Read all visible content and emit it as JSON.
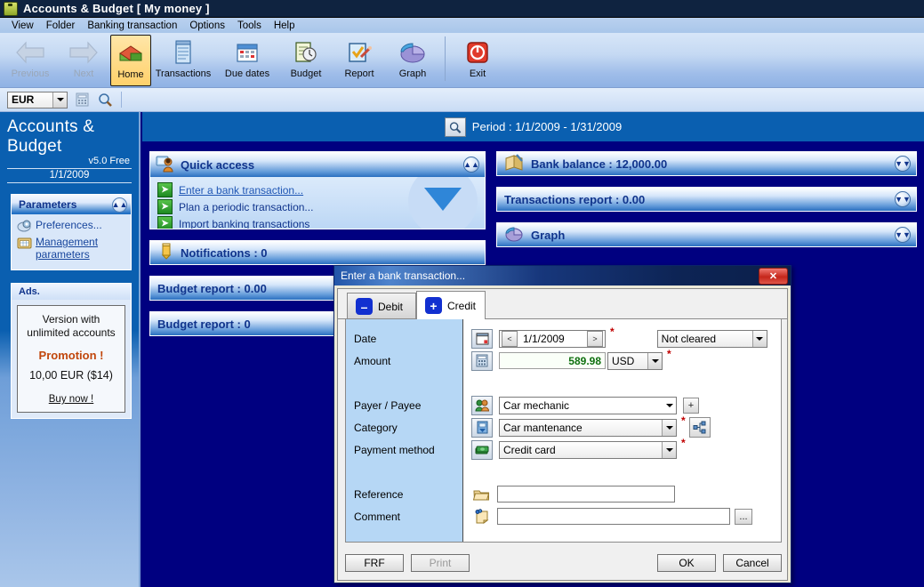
{
  "window": {
    "title": "Accounts & Budget [ My money ]",
    "icon": "money-bag-icon"
  },
  "menubar": {
    "items": [
      "View",
      "Folder",
      "Banking transaction",
      "Options",
      "Tools",
      "Help"
    ]
  },
  "toolbar": {
    "buttons": [
      {
        "label": "Previous",
        "icon": "left-arrow-icon",
        "enabled": false
      },
      {
        "label": "Next",
        "icon": "right-arrow-icon",
        "enabled": false
      },
      {
        "label": "Home",
        "icon": "house-icon",
        "enabled": true,
        "selected": true
      },
      {
        "label": "Transactions",
        "icon": "notepad-icon",
        "enabled": true
      },
      {
        "label": "Due dates",
        "icon": "calendar-icon",
        "enabled": true
      },
      {
        "label": "Budget",
        "icon": "clipboard-clock-icon",
        "enabled": true
      },
      {
        "label": "Report",
        "icon": "checklist-pen-icon",
        "enabled": true
      },
      {
        "label": "Graph",
        "icon": "pie-chart-icon",
        "enabled": true
      },
      {
        "label": "Exit",
        "icon": "power-icon",
        "enabled": true
      }
    ]
  },
  "currency_bar": {
    "selected_currency": "EUR",
    "calculator_icon": "calculator-icon",
    "search_icon": "magnifier-icon"
  },
  "sidebar": {
    "app_title": "Accounts & Budget",
    "version": "v5.0 Free",
    "date": "1/1/2009",
    "parameters_panel": {
      "title": "Parameters",
      "collapse_icon": "chevron-up-icon",
      "links": [
        {
          "label": "Preferences...",
          "icon": "preferences-icon",
          "underline": false
        },
        {
          "label": "Management parameters",
          "icon": "management-icon",
          "underline": true
        }
      ]
    },
    "ads_panel": {
      "title": "Ads.",
      "line1": "Version with unlimited accounts",
      "promo": "Promotion !",
      "price": "10,00 EUR ($14)",
      "buy": "Buy now !"
    }
  },
  "main": {
    "period": {
      "label": "Period : 1/1/2009 - 1/31/2009",
      "icon": "magnifier-icon"
    },
    "quick_access": {
      "title": "Quick access",
      "icon": "user-screen-icon",
      "collapse_icon": "chevron-up-icon",
      "links": [
        {
          "label": "Enter a bank transaction...",
          "icon": "green-arrow-icon",
          "link": true
        },
        {
          "label": "Plan a periodic transaction...",
          "icon": "green-arrow-icon",
          "link": false
        },
        {
          "label": "Import banking transactions",
          "icon": "green-arrow-icon",
          "link": false
        }
      ]
    },
    "left_bars": [
      {
        "label": "Notifications :  0",
        "icon": "bell-icon"
      },
      {
        "label": "Budget report : 0.00",
        "icon": ""
      },
      {
        "label": "Budget report : 0",
        "icon": ""
      }
    ],
    "right_bars": [
      {
        "label": "Bank balance :  12,000.00",
        "icon": "book-pen-icon",
        "expand_icon": "chevron-down-icon"
      },
      {
        "label": "Transactions report : 0.00",
        "icon": "",
        "expand_icon": "chevron-down-icon"
      },
      {
        "label": "Graph",
        "icon": "pie-chart-icon",
        "expand_icon": "chevron-down-icon"
      }
    ]
  },
  "dialog": {
    "title": "Enter a bank transaction...",
    "close_label": "✕",
    "tabs": [
      {
        "label": "Debit",
        "icon": "minus-icon",
        "active": false
      },
      {
        "label": "Credit",
        "icon": "plus-icon",
        "active": true
      }
    ],
    "fields": {
      "date": {
        "label": "Date",
        "value": "1/1/2009",
        "icon": "calendar-icon",
        "prev": "<",
        "next": ">",
        "required": "*"
      },
      "status": {
        "value": "Not cleared"
      },
      "amount": {
        "label": "Amount",
        "value": "589.98",
        "currency": "USD",
        "icon": "calculator-icon",
        "required": "*"
      },
      "payer": {
        "label": "Payer / Payee",
        "value": "Car mechanic",
        "icon": "people-icon",
        "add": "+"
      },
      "category": {
        "label": "Category",
        "value": "Car mantenance",
        "icon": "category-icon",
        "required": "*",
        "tree_icon": "hierarchy-icon"
      },
      "payment_method": {
        "label": "Payment method",
        "value": "Credit card",
        "icon": "money-icon",
        "required": "*"
      },
      "reference": {
        "label": "Reference",
        "value": "",
        "icon": "folder-icon"
      },
      "comment": {
        "label": "Comment",
        "value": "",
        "icon": "note-pin-icon",
        "browse": "..."
      }
    },
    "footer": {
      "frf": "FRF",
      "print": "Print",
      "ok": "OK",
      "cancel": "Cancel"
    }
  }
}
